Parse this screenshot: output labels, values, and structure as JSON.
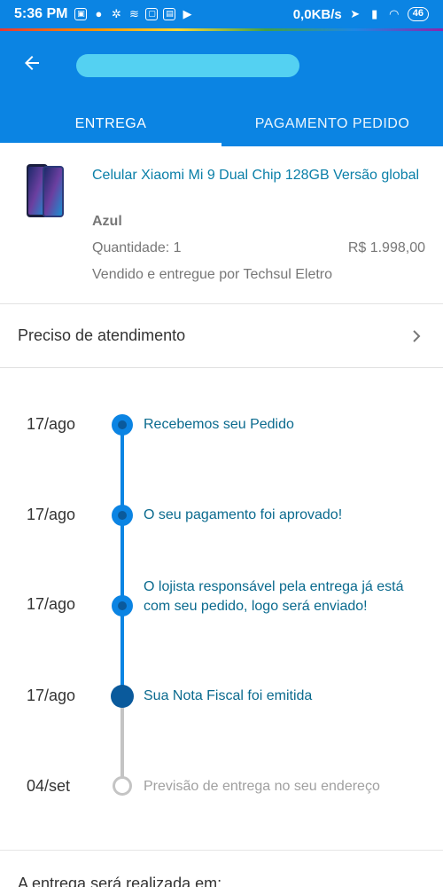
{
  "statusbar": {
    "time": "5:36 PM",
    "net_speed": "0,0KB/s",
    "battery": "46"
  },
  "header": {
    "tabs": [
      {
        "label": "ENTREGA"
      },
      {
        "label": "PAGAMENTO PEDIDO"
      }
    ]
  },
  "product": {
    "title": "Celular Xiaomi Mi 9 Dual Chip 128GB  Versão global",
    "color": "Azul",
    "quantity": "Quantidade: 1",
    "price": "R$ 1.998,00",
    "seller": "Vendido e entregue por Techsul Eletro"
  },
  "help": {
    "label": "Preciso de atendimento"
  },
  "timeline": [
    {
      "date": "17/ago",
      "text": "Recebemos seu Pedido",
      "state": "done"
    },
    {
      "date": "17/ago",
      "text": "O seu pagamento foi aprovado!",
      "state": "done"
    },
    {
      "date": "17/ago",
      "text": "O lojista responsável pela entrega já está com seu pedido, logo será enviado!",
      "state": "done"
    },
    {
      "date": "17/ago",
      "text": "Sua Nota Fiscal foi emitida",
      "state": "current"
    },
    {
      "date": "04/set",
      "text": "Previsão de entrega no seu endereço",
      "state": "pending"
    }
  ],
  "footer": {
    "text": "A entrega será realizada em:"
  },
  "colors": {
    "primary": "#0b84e3",
    "link_text": "#0a7fa8",
    "pending": "#c4c4c4"
  }
}
